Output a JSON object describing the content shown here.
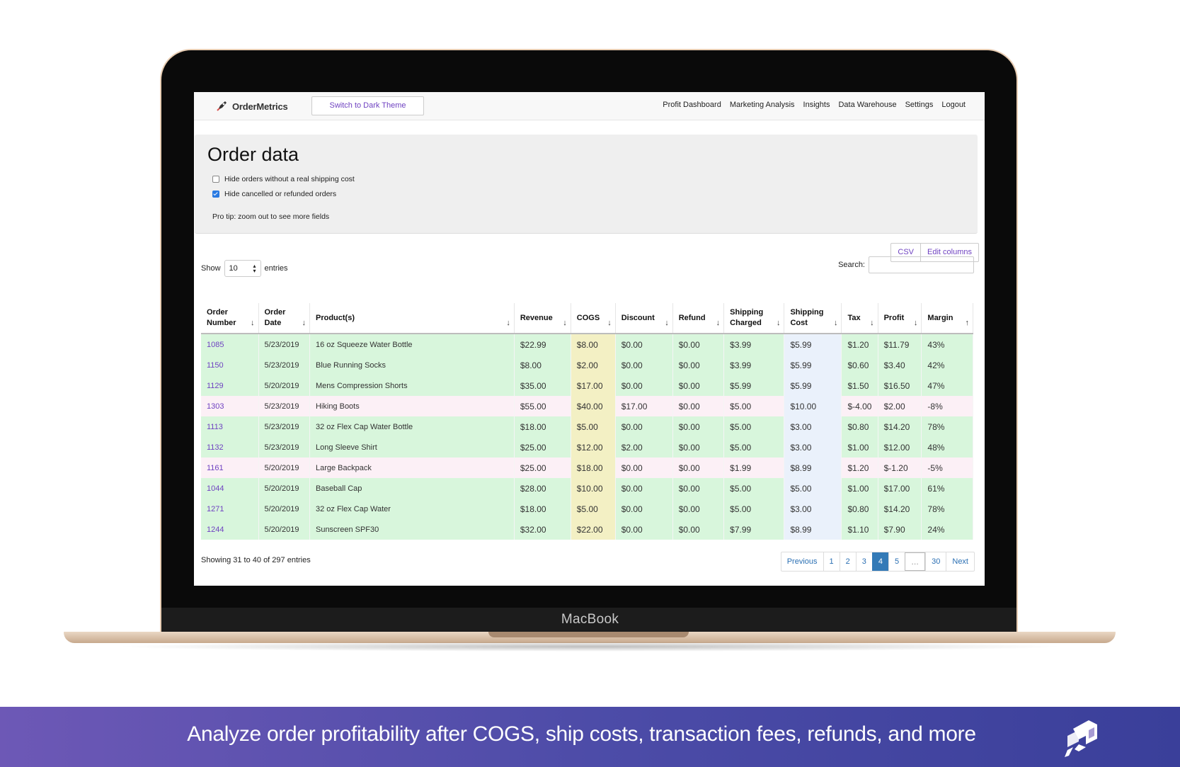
{
  "device": {
    "brand": "MacBook"
  },
  "nav": {
    "logo": "OrderMetrics",
    "theme_button": "Switch to Dark Theme",
    "links": [
      "Profit Dashboard",
      "Marketing Analysis",
      "Insights",
      "Data Warehouse",
      "Settings",
      "Logout"
    ]
  },
  "page": {
    "title": "Order data",
    "filters": [
      {
        "label": "Hide orders without a real shipping cost",
        "checked": false
      },
      {
        "label": "Hide cancelled or refunded orders",
        "checked": true
      }
    ],
    "protip": "Pro tip: zoom out to see more fields"
  },
  "toolbar": {
    "csv": "CSV",
    "edit_columns": "Edit columns"
  },
  "length": {
    "show": "Show",
    "value": "10",
    "entries": "entries"
  },
  "search": {
    "label": "Search:",
    "value": ""
  },
  "table": {
    "columns": [
      {
        "label": "Order Number",
        "sort": "↓"
      },
      {
        "label": "Order Date",
        "sort": "↓"
      },
      {
        "label": "Product(s)",
        "sort": "↓"
      },
      {
        "label": "Revenue",
        "sort": "↓"
      },
      {
        "label": "COGS",
        "sort": "↓"
      },
      {
        "label": "Discount",
        "sort": "↓"
      },
      {
        "label": "Refund",
        "sort": "↓"
      },
      {
        "label": "Shipping Charged",
        "sort": "↓"
      },
      {
        "label": "Shipping Cost",
        "sort": "↓"
      },
      {
        "label": "Tax",
        "sort": "↓"
      },
      {
        "label": "Profit",
        "sort": "↓"
      },
      {
        "label": "Margin",
        "sort": "↑"
      }
    ],
    "rows": [
      {
        "order": "1085",
        "date": "5/23/2019",
        "product": "16 oz Squeeze Water Bottle",
        "revenue": "$22.99",
        "cogs": "$8.00",
        "discount": "$0.00",
        "refund": "$0.00",
        "ship_charged": "$3.99",
        "ship_cost": "$5.99",
        "tax": "$1.20",
        "profit": "$11.79",
        "margin": "43%",
        "status": "pos"
      },
      {
        "order": "1150",
        "date": "5/23/2019",
        "product": "Blue Running Socks",
        "revenue": "$8.00",
        "cogs": "$2.00",
        "discount": "$0.00",
        "refund": "$0.00",
        "ship_charged": "$3.99",
        "ship_cost": "$5.99",
        "tax": "$0.60",
        "profit": "$3.40",
        "margin": "42%",
        "status": "pos"
      },
      {
        "order": "1129",
        "date": "5/20/2019",
        "product": "Mens Compression Shorts",
        "revenue": "$35.00",
        "cogs": "$17.00",
        "discount": "$0.00",
        "refund": "$0.00",
        "ship_charged": "$5.99",
        "ship_cost": "$5.99",
        "tax": "$1.50",
        "profit": "$16.50",
        "margin": "47%",
        "status": "pos"
      },
      {
        "order": "1303",
        "date": "5/23/2019",
        "product": "Hiking Boots",
        "revenue": "$55.00",
        "cogs": "$40.00",
        "discount": "$17.00",
        "refund": "$0.00",
        "ship_charged": "$5.00",
        "ship_cost": "$10.00",
        "tax": "$-4.00",
        "profit": "$2.00",
        "margin": "-8%",
        "status": "neg"
      },
      {
        "order": "1113",
        "date": "5/23/2019",
        "product": "32 oz Flex Cap Water Bottle",
        "revenue": "$18.00",
        "cogs": "$5.00",
        "discount": "$0.00",
        "refund": "$0.00",
        "ship_charged": "$5.00",
        "ship_cost": "$3.00",
        "tax": "$0.80",
        "profit": "$14.20",
        "margin": "78%",
        "status": "pos"
      },
      {
        "order": "1132",
        "date": "5/23/2019",
        "product": "Long Sleeve Shirt",
        "revenue": "$25.00",
        "cogs": "$12.00",
        "discount": "$2.00",
        "refund": "$0.00",
        "ship_charged": "$5.00",
        "ship_cost": "$3.00",
        "tax": "$1.00",
        "profit": "$12.00",
        "margin": "48%",
        "status": "pos"
      },
      {
        "order": "1161",
        "date": "5/20/2019",
        "product": "Large Backpack",
        "revenue": "$25.00",
        "cogs": "$18.00",
        "discount": "$0.00",
        "refund": "$0.00",
        "ship_charged": "$1.99",
        "ship_cost": "$8.99",
        "tax": "$1.20",
        "profit": "$-1.20",
        "margin": "-5%",
        "status": "neg"
      },
      {
        "order": "1044",
        "date": "5/20/2019",
        "product": "Baseball Cap",
        "revenue": "$28.00",
        "cogs": "$10.00",
        "discount": "$0.00",
        "refund": "$0.00",
        "ship_charged": "$5.00",
        "ship_cost": "$5.00",
        "tax": "$1.00",
        "profit": "$17.00",
        "margin": "61%",
        "status": "pos"
      },
      {
        "order": "1271",
        "date": "5/20/2019",
        "product": "32 oz Flex Cap Water",
        "revenue": "$18.00",
        "cogs": "$5.00",
        "discount": "$0.00",
        "refund": "$0.00",
        "ship_charged": "$5.00",
        "ship_cost": "$3.00",
        "tax": "$0.80",
        "profit": "$14.20",
        "margin": "78%",
        "status": "pos"
      },
      {
        "order": "1244",
        "date": "5/20/2019",
        "product": "Sunscreen SPF30",
        "revenue": "$32.00",
        "cogs": "$22.00",
        "discount": "$0.00",
        "refund": "$0.00",
        "ship_charged": "$7.99",
        "ship_cost": "$8.99",
        "tax": "$1.10",
        "profit": "$7.90",
        "margin": "24%",
        "status": "pos"
      }
    ]
  },
  "footer": {
    "info": "Showing 31 to 40 of 297 entries",
    "pagination": {
      "previous": "Previous",
      "pages": [
        "1",
        "2",
        "3",
        "4",
        "5",
        "…",
        "30"
      ],
      "active": "4",
      "next": "Next"
    }
  },
  "banner": {
    "tagline": "Analyze order profitability after COGS, ship costs, transaction fees, refunds, and more"
  },
  "colors": {
    "accent": "#6f42c1",
    "profit_row": "#d8f6dc",
    "loss_row": "#fcf0f6",
    "cogs_col": "#f3f0c4",
    "ship_cost_col": "#eaf1fb",
    "pagination_active": "#337ab7",
    "banner_start": "#6d58b6",
    "banner_end": "#3a3f9a"
  }
}
